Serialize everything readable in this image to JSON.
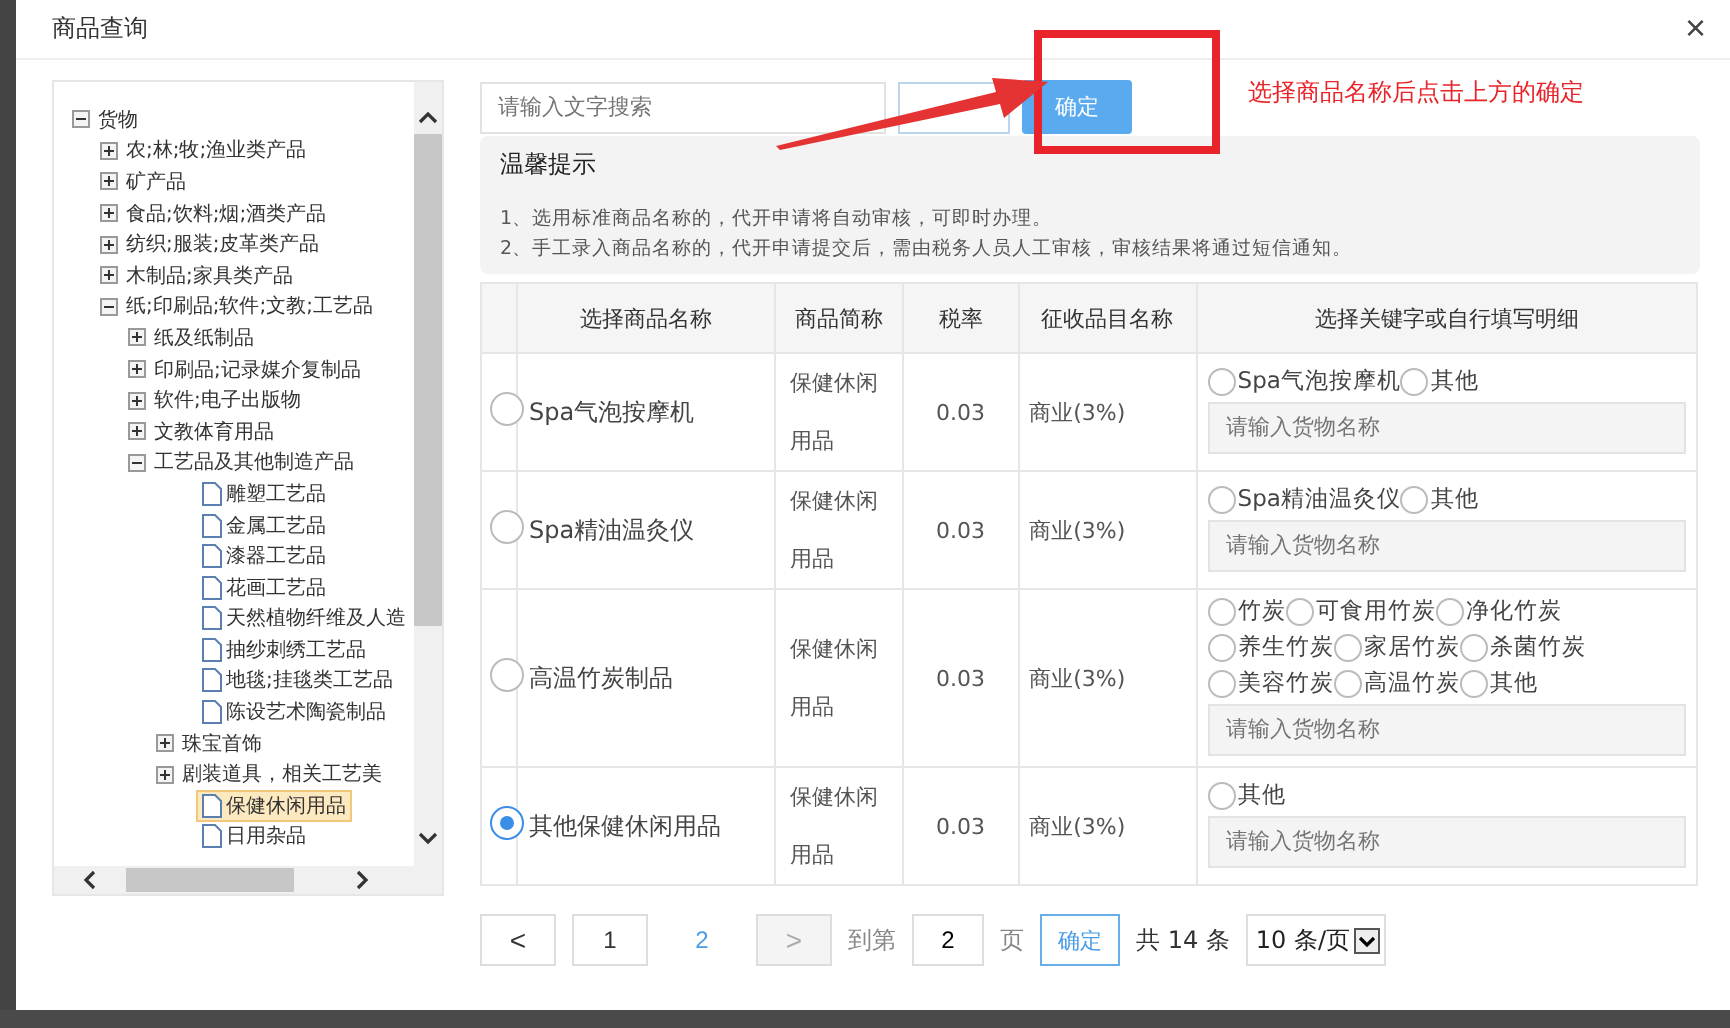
{
  "dialog": {
    "title": "商品查询",
    "close": "×"
  },
  "tree": [
    {
      "label": "货物",
      "kind": "folder",
      "expanded": true,
      "selected": false,
      "children": [
        {
          "label": "农;林;牧;渔业类产品",
          "kind": "folder",
          "expanded": false,
          "selected": false
        },
        {
          "label": "矿产品",
          "kind": "folder",
          "expanded": false,
          "selected": false
        },
        {
          "label": "食品;饮料;烟;酒类产品",
          "kind": "folder",
          "expanded": false,
          "selected": false
        },
        {
          "label": "纺织;服装;皮革类产品",
          "kind": "folder",
          "expanded": false,
          "selected": false
        },
        {
          "label": "木制品;家具类产品",
          "kind": "folder",
          "expanded": false,
          "selected": false
        },
        {
          "label": "纸;印刷品;软件;文教;工艺品",
          "kind": "folder",
          "expanded": true,
          "selected": false,
          "children": [
            {
              "label": "纸及纸制品",
              "kind": "folder",
              "expanded": false,
              "selected": false
            },
            {
              "label": "印刷品;记录媒介复制品",
              "kind": "folder",
              "expanded": false,
              "selected": false
            },
            {
              "label": "软件;电子出版物",
              "kind": "folder",
              "expanded": false,
              "selected": false
            },
            {
              "label": "文教体育用品",
              "kind": "folder",
              "expanded": false,
              "selected": false
            },
            {
              "label": "工艺品及其他制造产品",
              "kind": "folder",
              "expanded": true,
              "selected": false,
              "children": [
                {
                  "label": "雕塑工艺品",
                  "kind": "leaf",
                  "selected": false
                },
                {
                  "label": "金属工艺品",
                  "kind": "leaf",
                  "selected": false
                },
                {
                  "label": "漆器工艺品",
                  "kind": "leaf",
                  "selected": false
                },
                {
                  "label": "花画工艺品",
                  "kind": "leaf",
                  "selected": false
                },
                {
                  "label": "天然植物纤维及人造",
                  "kind": "leaf",
                  "selected": false
                },
                {
                  "label": "抽纱刺绣工艺品",
                  "kind": "leaf",
                  "selected": false
                },
                {
                  "label": "地毯;挂毯类工艺品",
                  "kind": "leaf",
                  "selected": false
                },
                {
                  "label": "陈设艺术陶瓷制品",
                  "kind": "leaf",
                  "selected": false
                },
                {
                  "label": "珠宝首饰",
                  "kind": "folder",
                  "expanded": false,
                  "selected": false
                },
                {
                  "label": "剧装道具，相关工艺美",
                  "kind": "folder",
                  "expanded": false,
                  "selected": false
                },
                {
                  "label": "保健休闲用品",
                  "kind": "leaf",
                  "selected": true
                },
                {
                  "label": "日用杂品",
                  "kind": "leaf",
                  "selected": false
                }
              ]
            }
          ]
        }
      ]
    }
  ],
  "search": {
    "placeholder": "请输入文字搜索"
  },
  "confirm_button": "确定",
  "annotation": {
    "text": "选择商品名称后点击上方的确定"
  },
  "tips": {
    "title": "温馨提示",
    "lines": [
      "1、选用标准商品名称的，代开申请将自动审核，可即时办理。",
      "2、手工录入商品名称的，代开申请提交后，需由税务人员人工审核，审核结果将通过短信通知。"
    ]
  },
  "table": {
    "columns": [
      "选择商品名称",
      "商品简称",
      "税率",
      "征收品目名称",
      "选择关键字或自行填写明细"
    ],
    "rows": [
      {
        "name": "Spa气泡按摩机",
        "abbr": "保健休闲用品",
        "rate": "0.03",
        "category": "商业(3%)",
        "selected": false,
        "options": [
          {
            "label": "Spa气泡按摩机",
            "selected": false
          },
          {
            "label": "其他",
            "selected": false
          }
        ],
        "placeholder": "请输入货物名称"
      },
      {
        "name": "Spa精油温灸仪",
        "abbr": "保健休闲用品",
        "rate": "0.03",
        "category": "商业(3%)",
        "selected": false,
        "options": [
          {
            "label": "Spa精油温灸仪",
            "selected": false
          },
          {
            "label": "其他",
            "selected": false
          }
        ],
        "placeholder": "请输入货物名称"
      },
      {
        "name": "高温竹炭制品",
        "abbr": "保健休闲用品",
        "rate": "0.03",
        "category": "商业(3%)",
        "selected": false,
        "options": [
          {
            "label": "竹炭",
            "selected": false
          },
          {
            "label": "可食用竹炭",
            "selected": false
          },
          {
            "label": "净化竹炭",
            "selected": false
          },
          {
            "label": "养生竹炭",
            "selected": false
          },
          {
            "label": "家居竹炭",
            "selected": false
          },
          {
            "label": "杀菌竹炭",
            "selected": false
          },
          {
            "label": "美容竹炭",
            "selected": false
          },
          {
            "label": "高温竹炭",
            "selected": false
          },
          {
            "label": "其他",
            "selected": false
          }
        ],
        "placeholder": "请输入货物名称"
      },
      {
        "name": "其他保健休闲用品",
        "abbr": "保健休闲用品",
        "rate": "0.03",
        "category": "商业(3%)",
        "selected": true,
        "options": [
          {
            "label": "其他",
            "selected": false
          }
        ],
        "placeholder": "请输入货物名称"
      }
    ]
  },
  "pagination": {
    "prev": "<",
    "pages": [
      {
        "label": "1",
        "selected": false
      },
      {
        "label": "2",
        "selected": true
      }
    ],
    "next": ">",
    "next_disabled": true,
    "goto_label": "到第",
    "goto_value": "2",
    "page_unit": "页",
    "goto_button": "确定",
    "total": "共 14 条",
    "page_size": "10 条/页"
  }
}
